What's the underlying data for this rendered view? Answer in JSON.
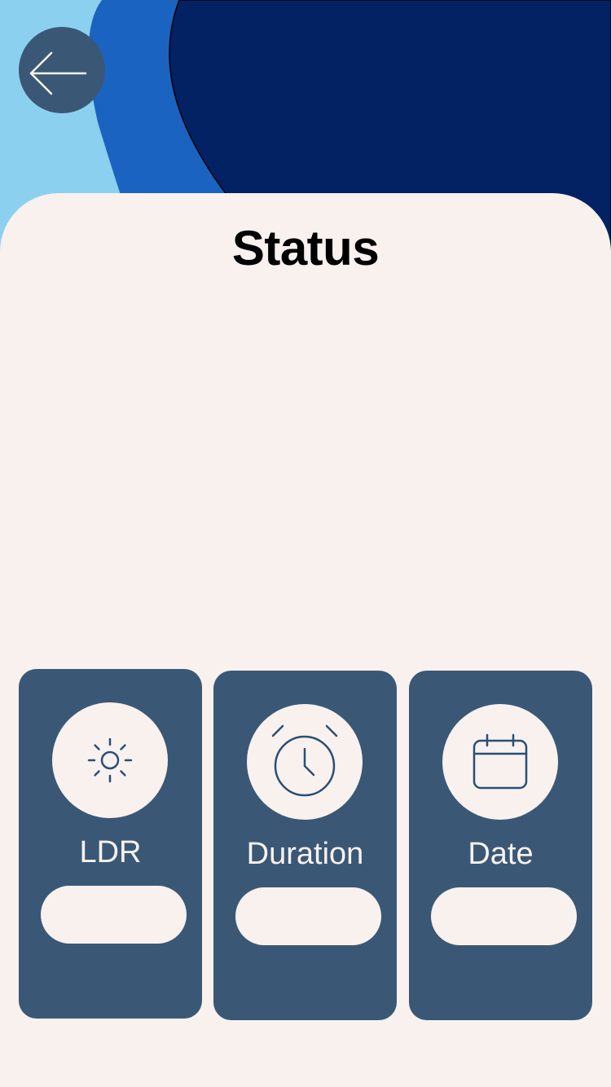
{
  "header": {
    "title": "Status",
    "back_icon": "arrow-left-icon"
  },
  "colors": {
    "background": "#f8f1ee",
    "card": "#3a5876",
    "wave_light": "#8cd0ef",
    "wave_mid": "#1a63c1",
    "wave_dark": "#032264",
    "icon_stroke": "#2a4f76"
  },
  "cards": [
    {
      "label": "LDR",
      "icon": "sun-icon",
      "value": ""
    },
    {
      "label": "Duration",
      "icon": "alarm-clock-icon",
      "value": ""
    },
    {
      "label": "Date",
      "icon": "calendar-icon",
      "value": ""
    }
  ]
}
